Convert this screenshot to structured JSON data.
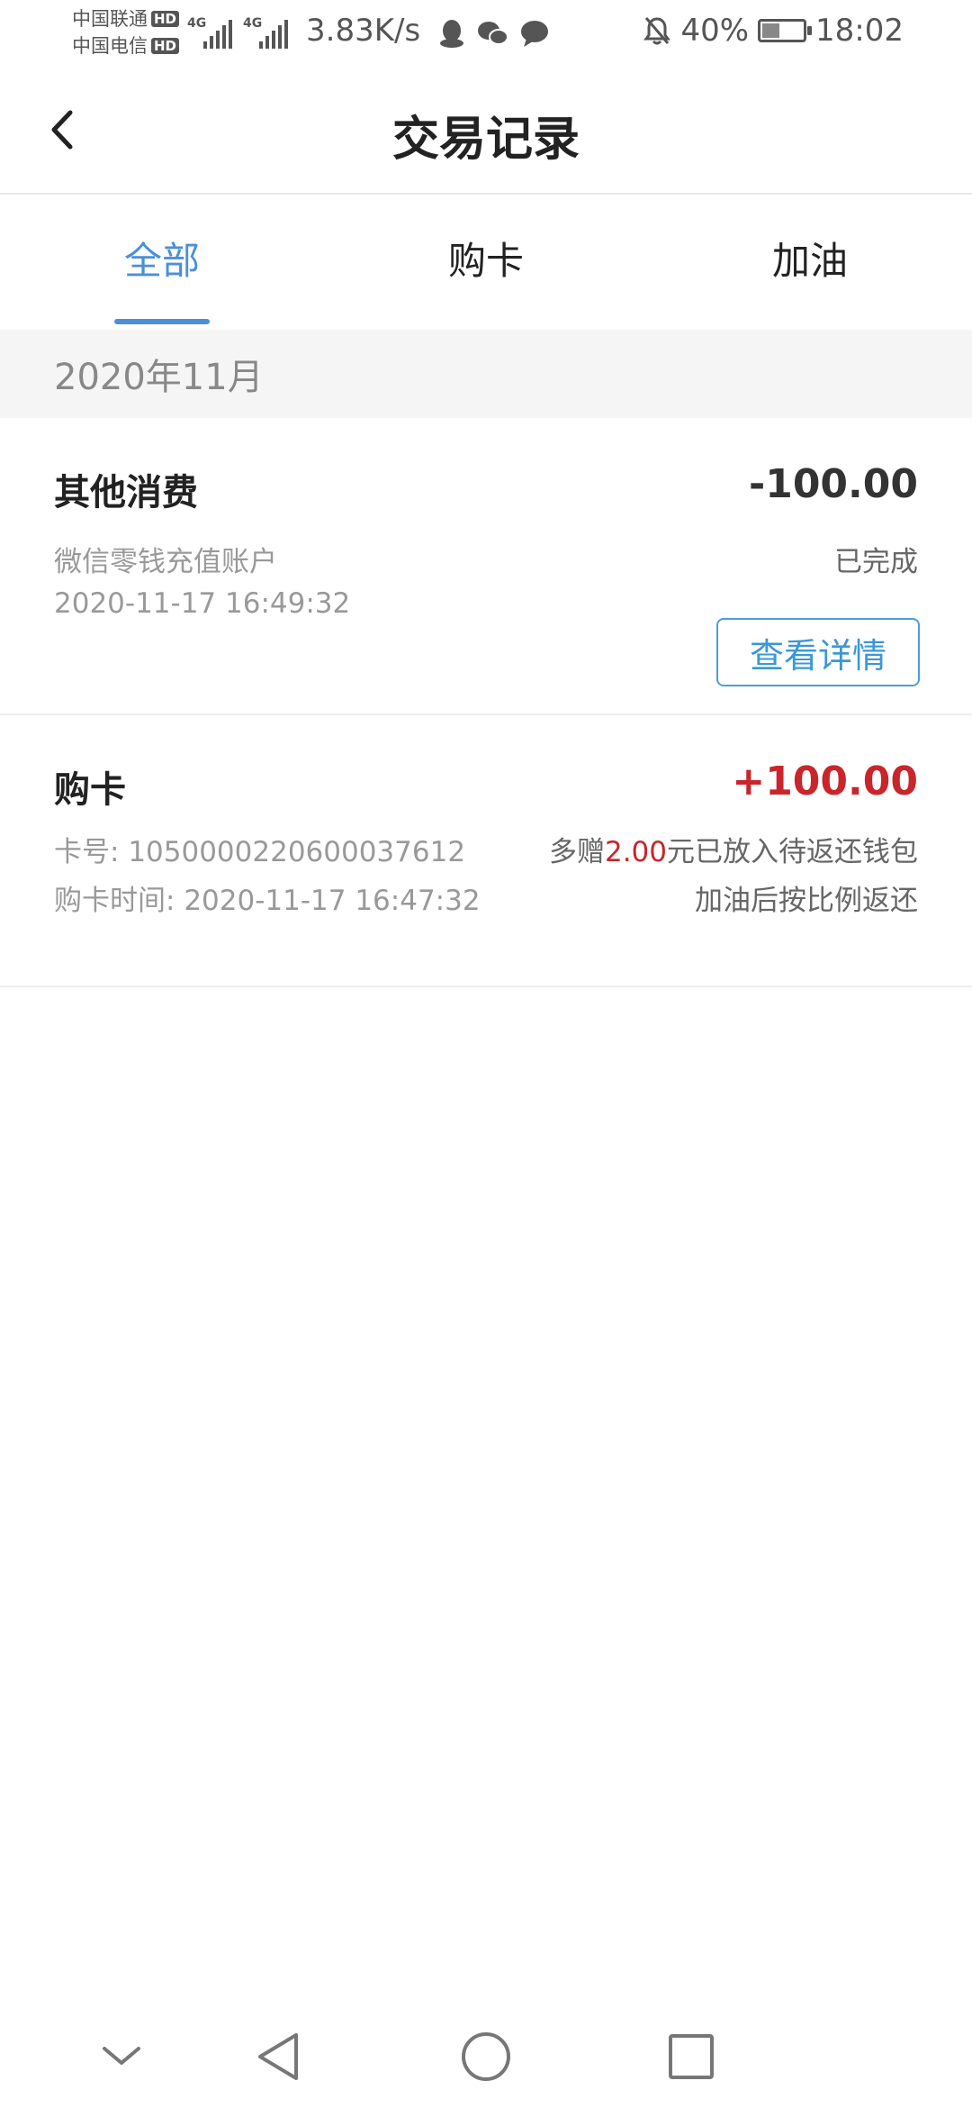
{
  "status_bar": {
    "carrier_1": "中国联通",
    "carrier_2": "中国电信",
    "hd_label": "HD",
    "network_label": "4G",
    "net_speed": "3.83K/s",
    "battery_percent": "40%",
    "battery_level": 0.4,
    "time": "18:02"
  },
  "header": {
    "title": "交易记录"
  },
  "tabs": [
    {
      "label": "全部",
      "active": true
    },
    {
      "label": "购卡",
      "active": false
    },
    {
      "label": "加油",
      "active": false
    }
  ],
  "month_header": "2020年11月",
  "records": [
    {
      "title": "其他消费",
      "amount": "-100.00",
      "line1": "微信零钱充值账户",
      "line2": "2020-11-17 16:49:32",
      "status": "已完成",
      "action_label": "查看详情"
    },
    {
      "title": "购卡",
      "amount": "+100.00",
      "card_no_label": "卡号: ",
      "card_no": "1050000220600037612",
      "time_label": "购卡时间: ",
      "time": "2020-11-17 16:47:32",
      "bonus_prefix": "多赠",
      "bonus_amount": "2.00",
      "bonus_suffix": "元已放入待返还钱包",
      "note": "加油后按比例返还"
    }
  ],
  "colors": {
    "accent": "#4a90d9",
    "negative_red": "#c8262b",
    "divider": "#ececec"
  }
}
